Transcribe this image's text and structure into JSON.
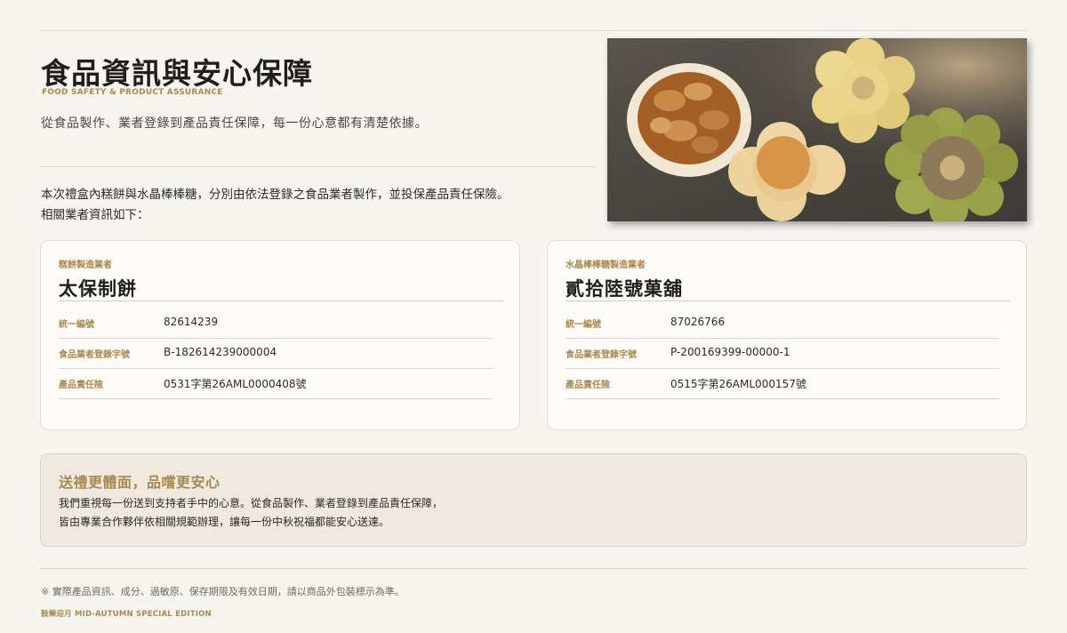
{
  "header": {
    "title": "食品資訊與安心保障",
    "subtitle_en": "FOOD SAFETY & PRODUCT ASSURANCE",
    "lead": "從食品製作、業者登錄到產品責任保障，每一份心意都有清楚依據。"
  },
  "intro": {
    "line1": "本次禮盒內糕餅與水晶棒棒糖，分別由依法登錄之食品業者製作，並投保產品責任保險。",
    "line2": "相關業者資訊如下："
  },
  "hero_image": {
    "colors": {
      "background": "#4a4640",
      "tart_crust": "#f3ead8",
      "nut_filling": "#b06a2b",
      "flower_yellow": "#e9d48a",
      "flower_green": "#9aa24a",
      "cookie_orange": "#d89a4a"
    }
  },
  "cards": [
    {
      "label": "糕餅製造業者",
      "name": "太保制餅",
      "rows": [
        {
          "key": "統一編號",
          "value": "82614239"
        },
        {
          "key": "食品業者登錄字號",
          "value": "B-182614239000004"
        },
        {
          "key": "產品責任險",
          "value": "0531字第26AML0000408號"
        }
      ]
    },
    {
      "label": "水晶棒棒糖製造業者",
      "name": "貳拾陸號菓舖",
      "rows": [
        {
          "key": "統一編號",
          "value": "87026766"
        },
        {
          "key": "食品業者登錄字號",
          "value": "P-200169399-00000-1"
        },
        {
          "key": "產品責任險",
          "value": "0515字第26AML000157號"
        }
      ]
    }
  ],
  "notice": {
    "title": "送禮更體面，品嚐更安心",
    "line1": "我們重視每一份送到支持者手中的心意。從食品製作、業者登錄到產品責任保障，",
    "line2": "皆由專業合作夥伴依相關規範辦理，讓每一份中秋祝福都能安心送達。"
  },
  "footer": {
    "note": "※ 實際產品資訊、成分、過敏原、保存期限及有效日期，請以商品外包裝標示為準。",
    "edition": "鼓樂迎月  MID-AUTUMN SPECIAL EDITION"
  },
  "colors": {
    "accent": "#a88a4f",
    "page_bg": "#f7f5f0",
    "card_bg": "#fdfcf9",
    "notice_bg": "#efe9df"
  }
}
